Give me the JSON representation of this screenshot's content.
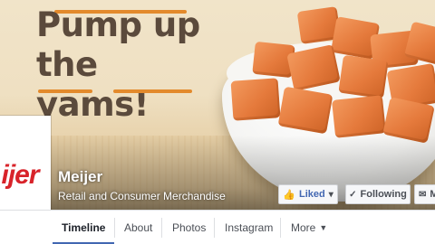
{
  "cover": {
    "headline_line1": "Pump up",
    "headline_line2": "the yams!"
  },
  "profile": {
    "logo_text": "ijer",
    "name": "Meijer",
    "category": "Retail and Consumer Merchandise"
  },
  "actions": {
    "liked_label": "Liked",
    "liked_caret": "▾",
    "following_label": "Following",
    "message_label": "M"
  },
  "tabs": [
    {
      "label": "Timeline"
    },
    {
      "label": "About"
    },
    {
      "label": "Photos"
    },
    {
      "label": "Instagram"
    },
    {
      "label": "More"
    }
  ],
  "icons": {
    "thumb": "thumbs-up-icon",
    "check": "check-icon",
    "message": "message-icon",
    "caret": "caret-down-icon"
  },
  "colors": {
    "accent": "#4267b2",
    "brand": "#d8232a",
    "headline": "#5b4a3c",
    "headline_rule": "#e38a2c"
  }
}
